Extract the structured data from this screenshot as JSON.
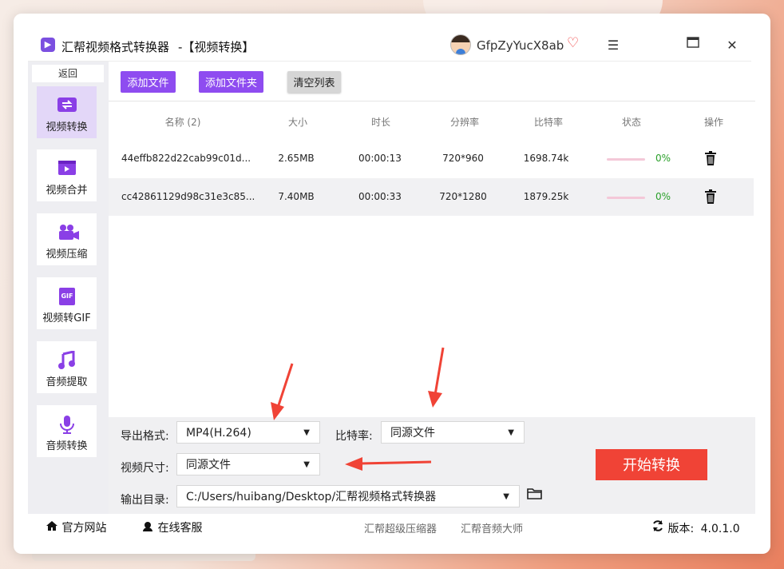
{
  "window": {
    "app_title": "汇帮视频格式转换器",
    "subtitle": "-【视频转换】",
    "username": "GfpZyYucX8ab",
    "icons": {
      "app": "video-app-icon",
      "vip": "vip-heart-icon",
      "menu": "menu-icon",
      "maximize": "maximize-icon",
      "close": "close-icon"
    }
  },
  "sidebar": {
    "back_label": "返回",
    "items": [
      {
        "label": "视频转换",
        "icon": "video-convert-icon",
        "glyph": "⇄",
        "active": true
      },
      {
        "label": "视频合并",
        "icon": "video-merge-icon",
        "glyph": "▶",
        "active": false
      },
      {
        "label": "视频压缩",
        "icon": "video-compress-icon",
        "glyph": "▣",
        "active": false
      },
      {
        "label": "视频转GIF",
        "icon": "gif-icon",
        "glyph": "GIF",
        "active": false
      },
      {
        "label": "音频提取",
        "icon": "music-note-icon",
        "glyph": "♫",
        "active": false
      },
      {
        "label": "音频转换",
        "icon": "microphone-icon",
        "glyph": "●",
        "active": false
      }
    ]
  },
  "toolbar": {
    "add_file": "添加文件",
    "add_folder": "添加文件夹",
    "clear_list": "清空列表"
  },
  "table": {
    "headers": [
      "名称 (2)",
      "大小",
      "时长",
      "分辨率",
      "比特率",
      "状态",
      "操作"
    ],
    "rows": [
      {
        "name": "44effb822d22cab99c01d...",
        "size": "2.65MB",
        "duration": "00:00:13",
        "resolution": "720*960",
        "bitrate": "1698.74k",
        "progress": "0%"
      },
      {
        "name": "cc42861129d98c31e3c85...",
        "size": "7.40MB",
        "duration": "00:00:33",
        "resolution": "720*1280",
        "bitrate": "1879.25k",
        "progress": "0%"
      }
    ]
  },
  "settings": {
    "format_label": "导出格式:",
    "format_value": "MP4(H.264)",
    "bitrate_label": "比特率:",
    "bitrate_value": "同源文件",
    "size_label": "视频尺寸:",
    "size_value": "同源文件",
    "output_label": "输出目录:",
    "output_value": "C:/Users/huibang/Desktop/汇帮视频格式转换器",
    "start_button": "开始转换"
  },
  "footer": {
    "website": "官方网站",
    "support": "在线客服",
    "link1": "汇帮超级压缩器",
    "link2": "汇帮音频大师",
    "version_label": "版本:",
    "version_value": "4.0.1.0"
  },
  "colors": {
    "accent": "#8e4cf0",
    "start_button": "#f04336",
    "annotation_arrow": "#f04336",
    "progress_done": "#2aa02a"
  }
}
